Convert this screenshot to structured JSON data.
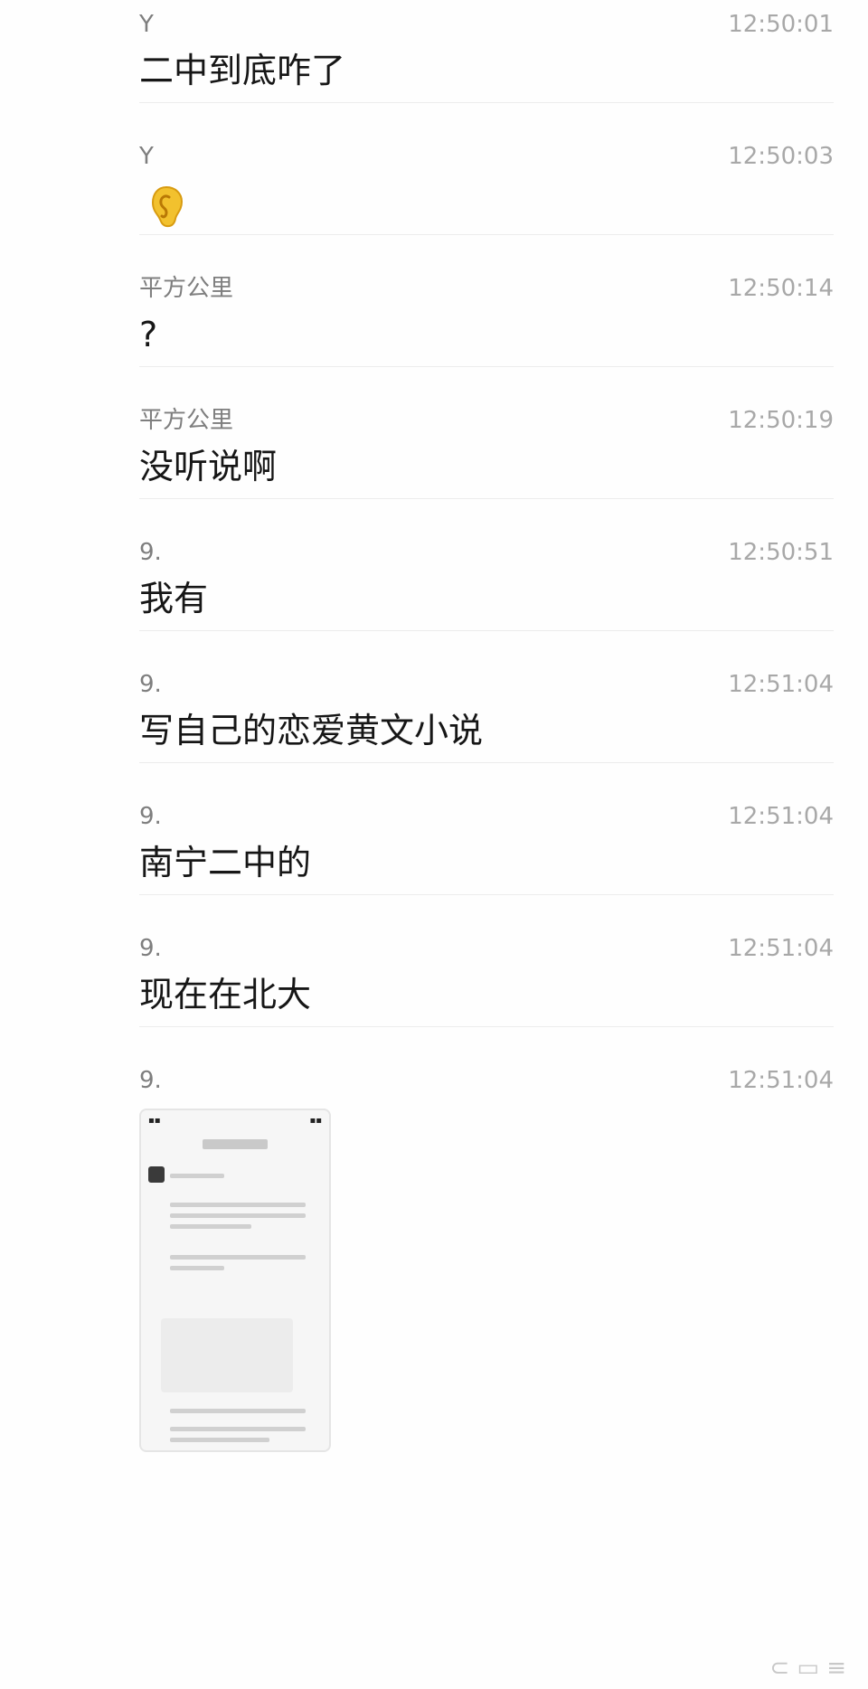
{
  "messages": [
    {
      "sender": "Y",
      "time": "12:50:01",
      "text": "二中到底咋了"
    },
    {
      "sender": "Y",
      "time": "12:50:03",
      "emoji": "ear-emoji"
    },
    {
      "sender": "平方公里",
      "time": "12:50:14",
      "text": "?"
    },
    {
      "sender": "平方公里",
      "time": "12:50:19",
      "text": "没听说啊"
    },
    {
      "sender": "9.",
      "time": "12:50:51",
      "text": "我有"
    },
    {
      "sender": "9.",
      "time": "12:51:04",
      "text": "写自己的恋爱黄文小说"
    },
    {
      "sender": "9.",
      "time": "12:51:04",
      "text": "南宁二中的"
    },
    {
      "sender": "9.",
      "time": "12:51:04",
      "text": "现在在北大"
    },
    {
      "sender": "9.",
      "time": "12:51:04",
      "image": "screenshot-thumbnail"
    }
  ],
  "colors": {
    "background": "#fefefe",
    "sender": "#7e7e7e",
    "time": "#a8a8a8",
    "text": "#161616",
    "divider": "#ececec",
    "ear_emoji": "#f2c12e"
  }
}
